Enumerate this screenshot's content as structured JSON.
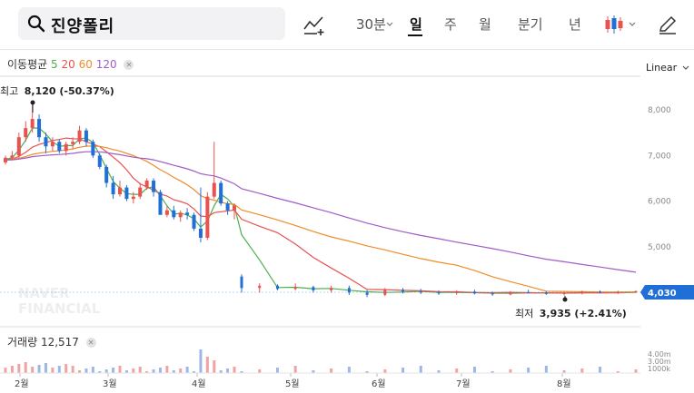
{
  "search": {
    "value": "진양폴리"
  },
  "toolbar": {
    "periods": [
      "30분",
      "일",
      "주",
      "월",
      "분기",
      "년"
    ],
    "active_period": "일"
  },
  "ma_legend": {
    "label": "이동평균",
    "periods": [
      "5",
      "20",
      "60",
      "120"
    ],
    "colors": [
      "#4caf50",
      "#e8524f",
      "#f08c28",
      "#a05cc8"
    ]
  },
  "scale_mode": "Linear",
  "high_label": {
    "text": "최고",
    "value": "8,120 (-50.37%)"
  },
  "low_label": {
    "text": "최저",
    "value": "3,935 (+2.41%)"
  },
  "current_price": "4,030",
  "watermark": [
    "NAVER",
    "FINANCIAL"
  ],
  "volume": {
    "label": "거래량",
    "value": "12,517",
    "axis_labels": [
      "4.00m",
      "3.00m",
      "1000k"
    ]
  },
  "colors": {
    "up": "#e8524f",
    "down": "#1f6fd6",
    "accent": "#1f6fd6"
  },
  "chart_data": {
    "type": "candlestick",
    "x_labels": [
      "2월",
      "3월",
      "4월",
      "5월",
      "6월",
      "7월",
      "8월"
    ],
    "y_ticks": [
      "8,000",
      "7,000",
      "6,000",
      "5,000"
    ],
    "ylim": [
      3700,
      8500
    ],
    "high": 8120,
    "low": 3935,
    "last": 4030,
    "ohlc": [
      [
        6850,
        7000,
        6800,
        6950
      ],
      [
        6950,
        7100,
        6900,
        7000
      ],
      [
        7000,
        7500,
        6950,
        7400
      ],
      [
        7400,
        7750,
        7300,
        7600
      ],
      [
        7600,
        8120,
        7500,
        7800
      ],
      [
        7800,
        7900,
        7300,
        7400
      ],
      [
        7400,
        7500,
        7050,
        7200
      ],
      [
        7200,
        7400,
        7100,
        7300
      ],
      [
        7300,
        7350,
        7050,
        7100
      ],
      [
        7100,
        7300,
        7000,
        7250
      ],
      [
        7250,
        7400,
        7150,
        7300
      ],
      [
        7300,
        7650,
        7250,
        7550
      ],
      [
        7550,
        7600,
        7200,
        7300
      ],
      [
        7300,
        7350,
        6950,
        7000
      ],
      [
        7000,
        7050,
        6700,
        6750
      ],
      [
        6750,
        6800,
        6300,
        6400
      ],
      [
        6400,
        6550,
        6050,
        6150
      ],
      [
        6150,
        6450,
        6100,
        6300
      ],
      [
        6300,
        6350,
        6000,
        6050
      ],
      [
        6050,
        6200,
        5950,
        6100
      ],
      [
        6100,
        6400,
        6050,
        6300
      ],
      [
        6300,
        6500,
        6250,
        6450
      ],
      [
        6450,
        6500,
        6100,
        6200
      ],
      [
        6200,
        6250,
        5800,
        5700
      ],
      [
        5700,
        5900,
        5650,
        5800
      ],
      [
        5800,
        5900,
        5600,
        5650
      ],
      [
        5650,
        5800,
        5550,
        5750
      ],
      [
        5750,
        5850,
        5600,
        5700
      ],
      [
        5700,
        5750,
        5350,
        5400
      ],
      [
        5400,
        6300,
        5100,
        5200
      ],
      [
        5200,
        6200,
        5150,
        6100
      ],
      [
        6100,
        7300,
        6050,
        6400
      ],
      [
        6400,
        6450,
        5900,
        5950
      ],
      [
        5950,
        6000,
        5700,
        5800
      ],
      [
        5800,
        5950,
        5600,
        5900
      ],
      [
        4350,
        4400,
        4000,
        4100
      ],
      [
        4100,
        4200,
        4000,
        4150
      ],
      [
        4150,
        4180,
        4050,
        4080
      ],
      [
        4080,
        4200,
        4050,
        4120
      ],
      [
        4120,
        4150,
        4000,
        4050
      ],
      [
        4050,
        4150,
        4000,
        4100
      ],
      [
        4100,
        4150,
        3950,
        4000
      ],
      [
        4000,
        4050,
        3900,
        3950
      ],
      [
        3950,
        4100,
        3920,
        4060
      ],
      [
        4060,
        4100,
        3980,
        4020
      ],
      [
        4020,
        4080,
        3970,
        4000
      ],
      [
        4000,
        4050,
        3950,
        3990
      ],
      [
        3990,
        4050,
        3950,
        4020
      ],
      [
        4020,
        4060,
        3960,
        3980
      ],
      [
        3980,
        4020,
        3930,
        3960
      ],
      [
        3960,
        4030,
        3940,
        4010
      ],
      [
        4010,
        4060,
        3980,
        4000
      ],
      [
        4000,
        4030,
        3950,
        3970
      ],
      [
        3970,
        4010,
        3935,
        3990
      ],
      [
        3990,
        4040,
        3960,
        4020
      ],
      [
        4020,
        4050,
        3980,
        4000
      ],
      [
        4000,
        4040,
        3970,
        4010
      ],
      [
        4010,
        4050,
        3990,
        4030
      ]
    ]
  }
}
